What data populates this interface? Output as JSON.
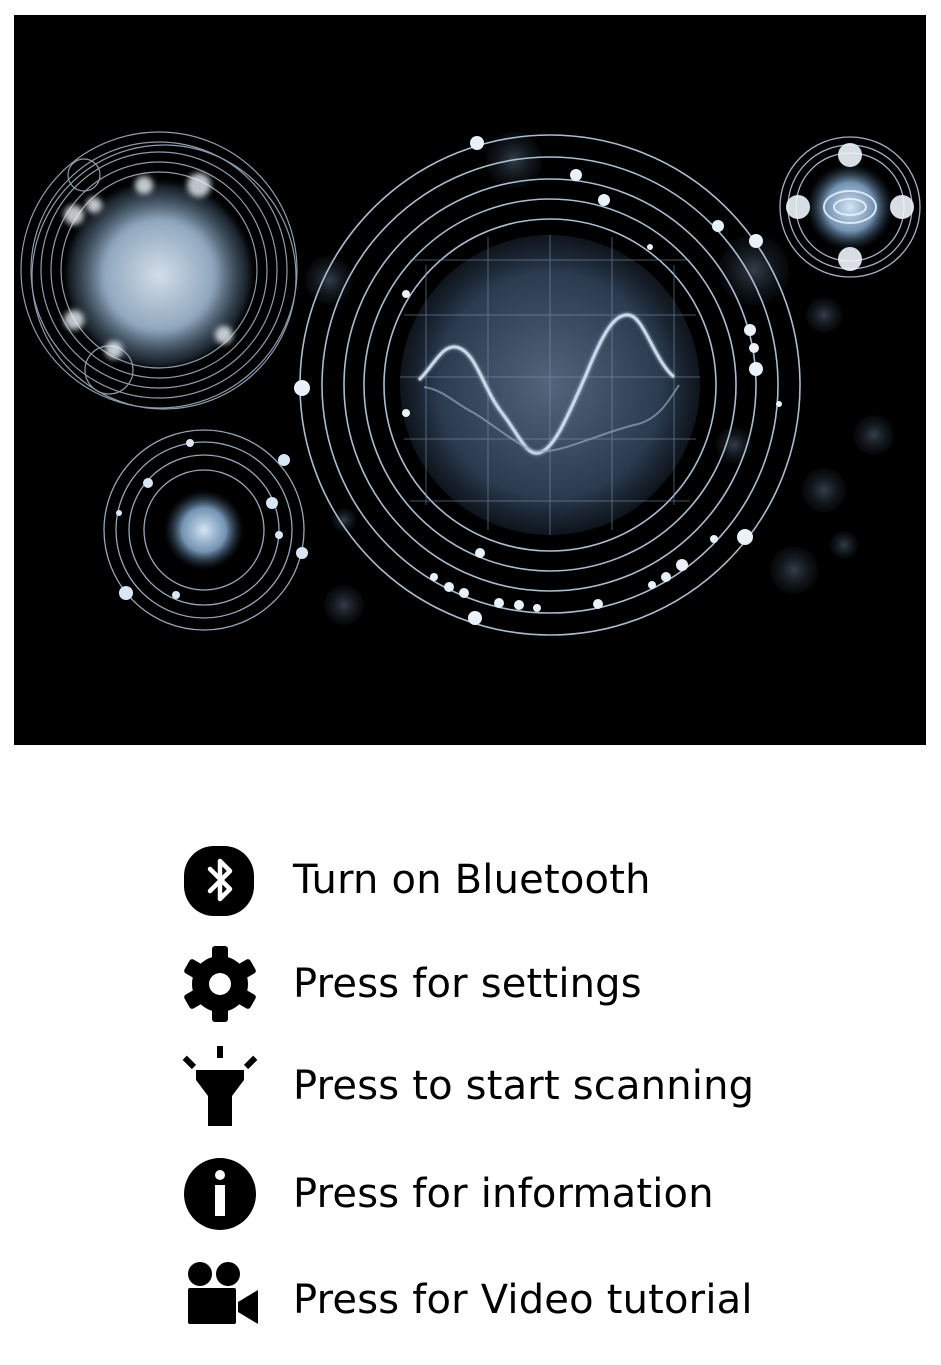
{
  "hero": {
    "name": "scanner-hero-artwork"
  },
  "legend": {
    "items": [
      {
        "icon": "bluetooth-icon",
        "label": "Turn on Bluetooth"
      },
      {
        "icon": "gear-icon",
        "label": "Press for settings"
      },
      {
        "icon": "flashlight-icon",
        "label": "Press to start scanning"
      },
      {
        "icon": "info-icon",
        "label": "Press for information"
      },
      {
        "icon": "video-camera-icon",
        "label": "Press for Video tutorial"
      }
    ]
  },
  "colors": {
    "hero_background": "#000000",
    "ring": "#bcd2ea",
    "glow": "#9fc3e4",
    "icon": "#000000",
    "text": "#000000"
  }
}
